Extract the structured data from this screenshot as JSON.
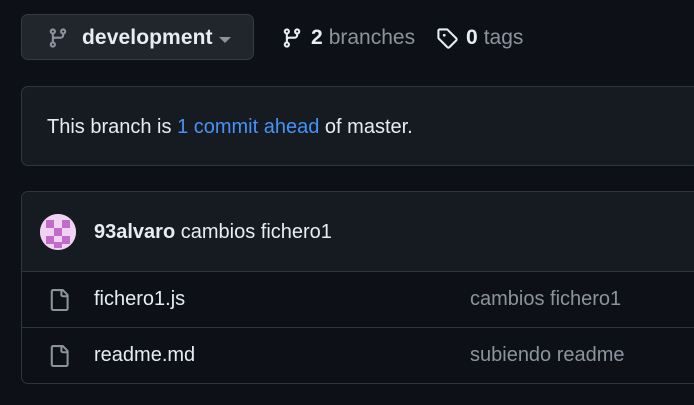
{
  "branch_selector": {
    "current_branch": "development",
    "icon": "git-branch-icon"
  },
  "branches_link": {
    "count": "2",
    "label": "branches",
    "icon": "git-branch-icon"
  },
  "tags_link": {
    "count": "0",
    "label": "tags",
    "icon": "tag-icon"
  },
  "ahead_notice": {
    "prefix": "This branch is",
    "link_text": "1 commit ahead",
    "suffix": "of master."
  },
  "latest_commit": {
    "author": "93alvaro",
    "message": "cambios fichero1"
  },
  "files": [
    {
      "name": "fichero1.js",
      "last_commit_message": "cambios fichero1",
      "icon": "file-icon"
    },
    {
      "name": "readme.md",
      "last_commit_message": "subiendo readme",
      "icon": "file-icon"
    }
  ],
  "colors": {
    "background": "#0d1117",
    "link": "#4493f8",
    "muted": "#8b949e",
    "avatar": "#f0c8f0"
  }
}
